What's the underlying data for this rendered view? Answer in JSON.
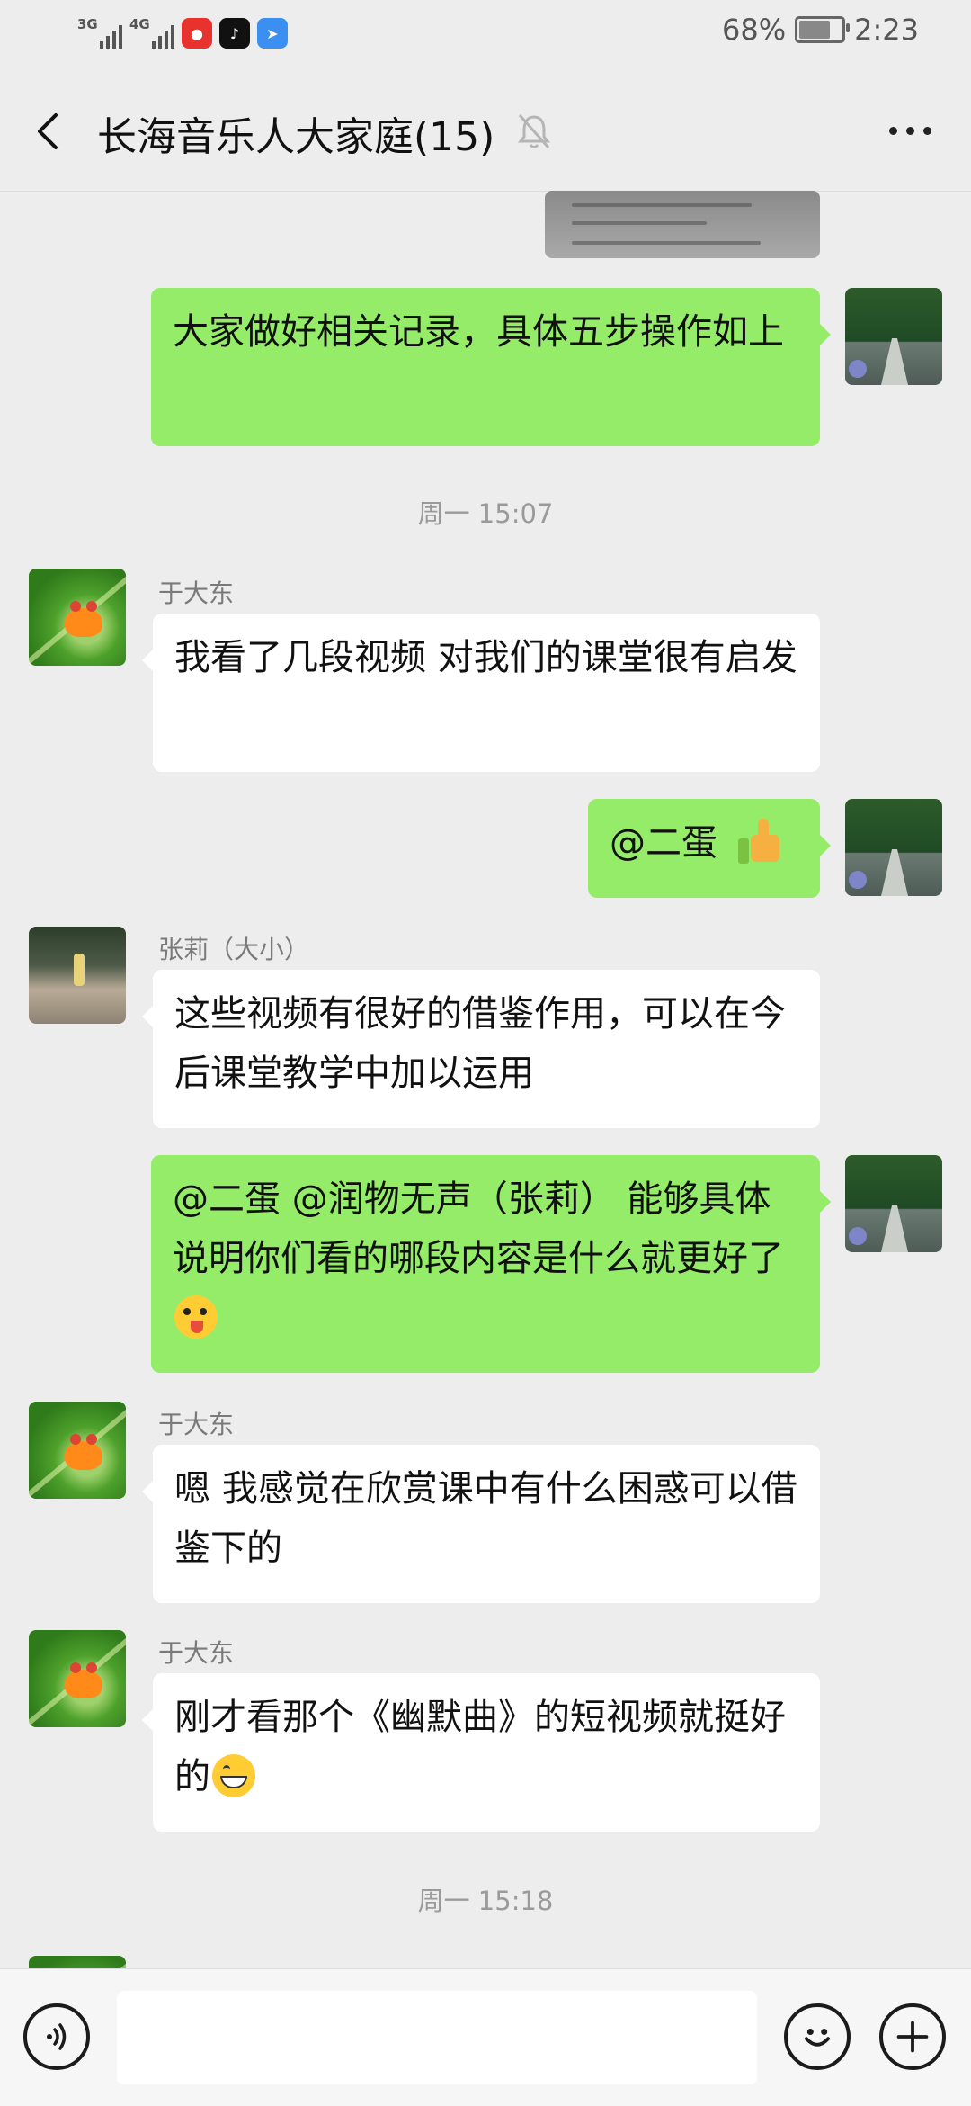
{
  "status_bar": {
    "network1": "3G",
    "network2": "4G",
    "battery": "68%",
    "battery_level": 0.68,
    "time": "2:23",
    "app_icons": [
      "weibo-icon",
      "tiktok-icon",
      "feishu-icon"
    ]
  },
  "header": {
    "title": "长海音乐人大家庭(15)",
    "back_icon": "chevron-left-icon",
    "mute_icon": "bell-off-icon",
    "more_icon": "more-dots-icon"
  },
  "messages": [
    {
      "type": "image",
      "side": "out",
      "content": "document-image"
    },
    {
      "type": "text",
      "side": "out",
      "text": "大家做好相关记录，具体五步操作如上"
    },
    {
      "type": "time",
      "text": "周一 15:07"
    },
    {
      "type": "text",
      "side": "in",
      "sender": "于大东",
      "text": "我看了几段视频  对我们的课堂很有启发"
    },
    {
      "type": "text",
      "side": "out",
      "text": "@二蛋 ",
      "emoji": "thumbs-up"
    },
    {
      "type": "text",
      "side": "in",
      "sender": "张莉（大小）",
      "text": "这些视频有很好的借鉴作用，可以在今后课堂教学中加以运用"
    },
    {
      "type": "text",
      "side": "out",
      "text": "@二蛋  @润物无声（张莉） 能够具体说明你们看的哪段内容是什么就更好了",
      "emoji": "winking-tongue"
    },
    {
      "type": "text",
      "side": "in",
      "sender": "于大东",
      "text": "嗯  我感觉在欣赏课中有什么困惑可以借鉴下的"
    },
    {
      "type": "text",
      "side": "in",
      "sender": "于大东",
      "text": "刚才看那个《幽默曲》的短视频就挺好的",
      "emoji": "grinning"
    },
    {
      "type": "time",
      "text": "周一 15:18"
    }
  ],
  "input_bar": {
    "voice_icon": "voice-icon",
    "input_value": "",
    "emoji_icon": "emoji-icon",
    "plus_icon": "plus-icon"
  }
}
